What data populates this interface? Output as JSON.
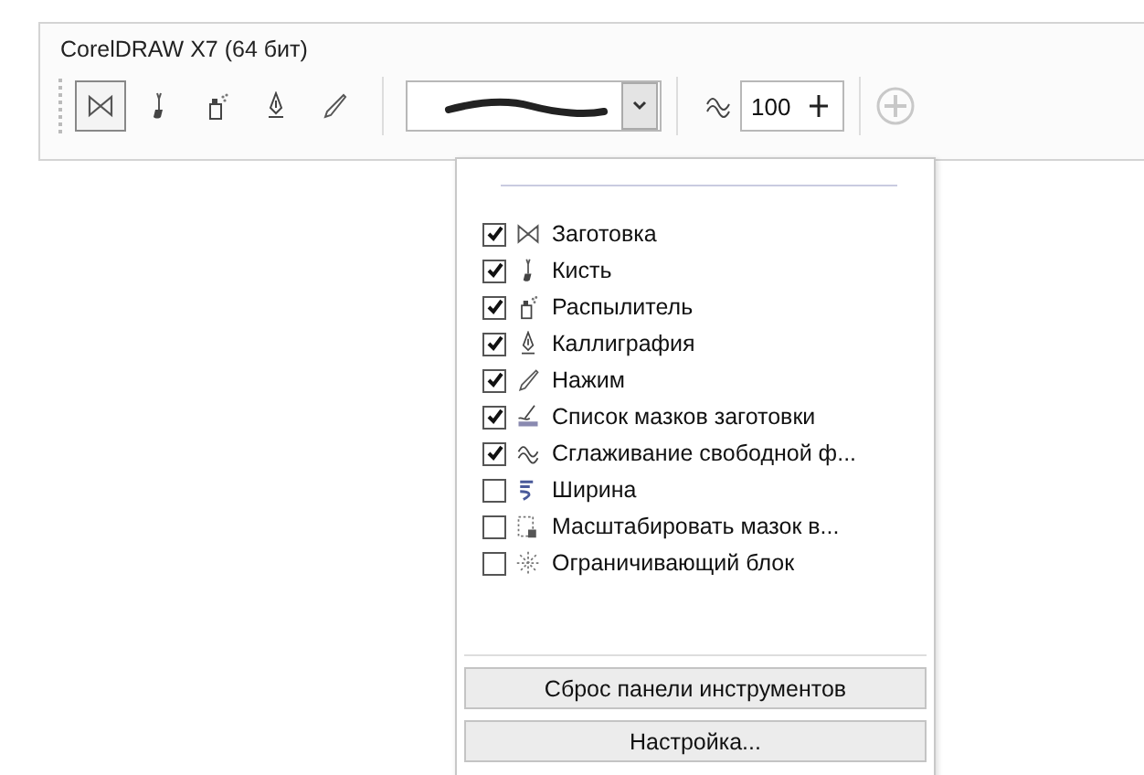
{
  "window": {
    "title": "CorelDRAW X7 (64 бит)"
  },
  "toolbar": {
    "tools": [
      {
        "kind": "preset",
        "selected": true
      },
      {
        "kind": "brush",
        "selected": false
      },
      {
        "kind": "sprayer",
        "selected": false
      },
      {
        "kind": "calligraphy",
        "selected": false
      },
      {
        "kind": "pressure",
        "selected": false
      }
    ],
    "smoothing": {
      "value": "100"
    }
  },
  "menu": {
    "items": [
      {
        "kind": "preset",
        "label": "Заготовка",
        "checked": true
      },
      {
        "kind": "brush",
        "label": "Кисть",
        "checked": true
      },
      {
        "kind": "sprayer",
        "label": "Распылитель",
        "checked": true
      },
      {
        "kind": "calligraphy",
        "label": "Каллиграфия",
        "checked": true
      },
      {
        "kind": "pressure",
        "label": "Нажим",
        "checked": true
      },
      {
        "kind": "stroke-list",
        "label": "Список мазков заготовки",
        "checked": true
      },
      {
        "kind": "smoothing",
        "label": "Сглаживание свободной ф...",
        "checked": true
      },
      {
        "kind": "width",
        "label": "Ширина",
        "checked": false
      },
      {
        "kind": "scale",
        "label": "Масштабировать мазок в...",
        "checked": false
      },
      {
        "kind": "bounding",
        "label": "Ограничивающий блок",
        "checked": false
      }
    ],
    "buttons": [
      "Сброс панели инструментов",
      "Настройка..."
    ]
  }
}
